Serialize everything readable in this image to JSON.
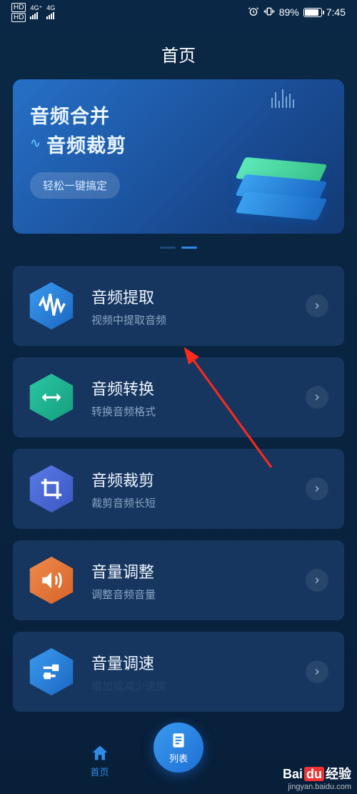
{
  "status": {
    "hd1": "HD",
    "hd2": "HD",
    "sig1_label": "4G⁺",
    "sig2_label": "4G",
    "alarm_icon": "alarm-icon",
    "vibrate_icon": "vibrate-icon",
    "battery_pct": "89%",
    "time": "7:45"
  },
  "page_title": "首页",
  "banner": {
    "line1": "音频合并",
    "line2": "音频裁剪",
    "chip": "轻松一键搞定"
  },
  "carousel": {
    "count": 2,
    "active_index": 1
  },
  "cards": [
    {
      "title": "音频提取",
      "sub": "视频中提取音频",
      "icon": "waveform-icon",
      "hex_color_a": "#3a9bf0",
      "hex_color_b": "#1c66c0"
    },
    {
      "title": "音频转换",
      "sub": "转换音频格式",
      "icon": "swap-icon",
      "hex_color_a": "#2bc7a5",
      "hex_color_b": "#159e7d"
    },
    {
      "title": "音频裁剪",
      "sub": "裁剪音频长短",
      "icon": "crop-icon",
      "hex_color_a": "#5a7be8",
      "hex_color_b": "#3a56c0"
    },
    {
      "title": "音量调整",
      "sub": "调整音频音量",
      "icon": "volume-icon",
      "hex_color_a": "#f08a4a",
      "hex_color_b": "#d6642a"
    },
    {
      "title": "音量调速",
      "sub": "增加或减少速度",
      "icon": "slider-icon",
      "hex_color_a": "#3a9bf0",
      "hex_color_b": "#1c66c0"
    }
  ],
  "nav": {
    "home": "首页",
    "list": "列表"
  },
  "watermark": {
    "brand_a": "Bai",
    "brand_b": "du",
    "brand_c": "经验",
    "url": "jingyan.baidu.com"
  }
}
